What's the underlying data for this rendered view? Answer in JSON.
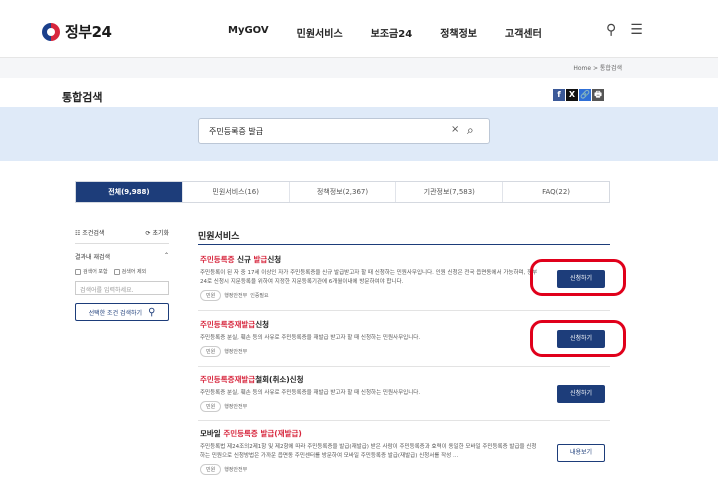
{
  "header": {
    "logo_text": "정부24",
    "nav": [
      "MyGOV",
      "민원서비스",
      "보조금24",
      "정책정보",
      "고객센터"
    ],
    "search_icon": "search-icon",
    "menu_icon": "menu-icon"
  },
  "breadcrumb": "Home > 통합검색",
  "page_title": "통합검색",
  "share": [
    "f",
    "X",
    "🔗",
    "🖶"
  ],
  "search": {
    "value": "주민등록증 발급",
    "clear": "×",
    "button": "⌕"
  },
  "tabs": [
    "전체(9,988)",
    "민원서비스(16)",
    "정책정보(2,367)",
    "기관정보(7,583)",
    "FAQ(22)"
  ],
  "filter": {
    "head": "조건검색",
    "reset": "초기화",
    "sub": "결과내 재검색",
    "check1": "검색어 포함",
    "check2": "검색어 제외",
    "placeholder": "검색어를 입력하세요.",
    "apply": "선택한 조건 검색하기"
  },
  "section_title": "민원서비스",
  "items": [
    {
      "title_hl": "주민등록증",
      "title_mid": " 신규 ",
      "title_hl2": "발급",
      "title_tail": "신청",
      "desc": "주민등록이 된 자 중 17세 이상인 자가 주민등록증을 신규 발급받고자 할 때 신청하는 민원사무입니다. 인원 신청은 전국 읍면동에서 가능하며, 정부24로 신청시 지문등록을 위하여 지정한 지문등록기관에 6개월이내에 방문하여야 합니다.",
      "tag": "민원",
      "org": "행정안전부",
      "extra": "인증필요",
      "button": "신청하기"
    },
    {
      "title_hl": "주민등록증",
      "title_mid": "재",
      "title_hl2": "발급",
      "title_tail": "신청",
      "desc": "주민등록증 분실, 훼손 등의 사유로 주민등록증을 재발급 받고자 할 때 신청하는 민원사무입니다.",
      "tag": "민원",
      "org": "행정안전부",
      "button": "신청하기"
    },
    {
      "title_hl": "주민등록증",
      "title_mid": "재",
      "title_hl2": "발급",
      "title_tail": "철회(취소)신청",
      "desc": "주민등록증 분실, 훼손 등의 사유로 주민등록증을 재발급 받고자 할 때 신청하는 민원사무입니다.",
      "tag": "민원",
      "org": "행정안전부",
      "button": "신청하기"
    },
    {
      "title_pre": "모바일 ",
      "title_hl": "주민등록증",
      "title_mid": " ",
      "title_hl2": "발급",
      "title_tail": "(재발급)",
      "desc": "주민등록법 제24조의2제1항 및 제2항에 따라 주민등록증을 발급(재발급) 받은 사람이 주민등록증과 효력이 동일한 모바일 주민등록증 발급을 신청하는 민원으로 신청방법은 가까운 읍면동 주민센터를 방문하여 모바일 주민등록증 발급(재발급) 신청서를 작성 ...",
      "tag": "민원",
      "org": "행정안전부",
      "button": "내용보기"
    }
  ]
}
